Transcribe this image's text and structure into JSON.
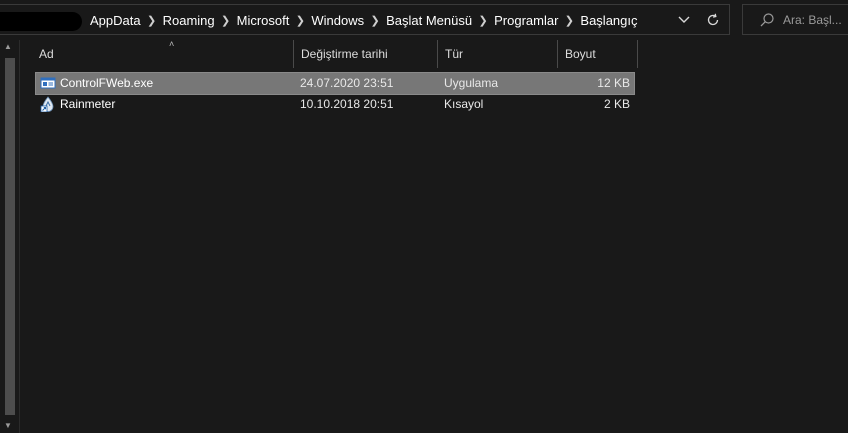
{
  "breadcrumb": {
    "items": [
      "AppData",
      "Roaming",
      "Microsoft",
      "Windows",
      "Başlat Menüsü",
      "Programlar",
      "Başlangıç"
    ]
  },
  "search": {
    "placeholder": "Ara: Başl..."
  },
  "columns": {
    "name": "Ad",
    "date": "Değiştirme tarihi",
    "type": "Tür",
    "size": "Boyut"
  },
  "files": [
    {
      "name": "ControlFWeb.exe",
      "date": "24.07.2020 23:51",
      "type": "Uygulama",
      "size": "12 KB",
      "icon": "application-icon",
      "selected": true
    },
    {
      "name": "Rainmeter",
      "date": "10.10.2018 20:51",
      "type": "Kısayol",
      "size": "2 KB",
      "icon": "rainmeter-shortcut-icon",
      "selected": false
    }
  ],
  "colors": {
    "background": "#191919",
    "selection": "#777777",
    "border": "#3a3a3a"
  }
}
